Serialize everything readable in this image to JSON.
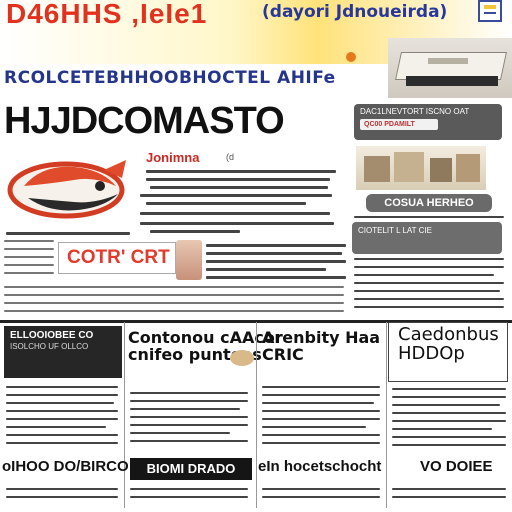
{
  "masthead": {
    "red_title": "D46HHS ,IeIe1",
    "blue_title": "(dayori Jdnoueirda)",
    "nameplate": "RCOLCETEBHHOOBHOCTEL AHIFe"
  },
  "headline": {
    "main": "HJJDCOMASTO"
  },
  "article": {
    "kicker": "Jonimna",
    "kicker_tail": "(d"
  },
  "right_column": {
    "pill": "COSUA HERHEO",
    "box1_label": "QC00 PDAMILT",
    "box1_text": "DAC1LNEVTORT ISCNO OAT",
    "box2_text": "CIOTELIT L LAT CIE"
  },
  "promo": {
    "logo_text": "COTR' CRT"
  },
  "lower_section": {
    "box1_title": "ELLOOIOBEE CO",
    "box1_sub": "ISOLCHO UF OLLCO",
    "col2_headline_l1": "Contonou cAAcor",
    "col2_headline_l2": "cnifeo punteas",
    "col3_headline_l1": "Arenbity Haa",
    "col3_headline_l2": "CRIC",
    "col4_headline_l1": "Caedonbus",
    "col4_headline_l2": "HDDOp",
    "bottom_1": "oIHOO DO/BIRCO",
    "bottom_2": "BIOMI DRADO",
    "bottom_3": "eIn hocetschocht",
    "bottom_3b": "VO DOIEE"
  },
  "colors": {
    "accent_red": "#e0321f",
    "brand_blue": "#26358c",
    "yellow": "#ffe27a"
  }
}
